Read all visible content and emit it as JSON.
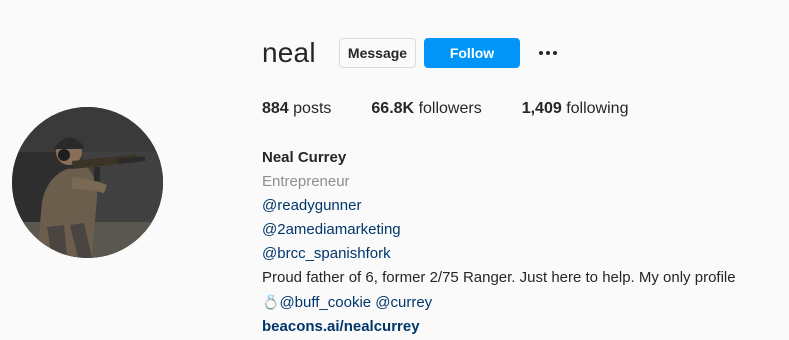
{
  "profile": {
    "username": "neal",
    "message_label": "Message",
    "follow_label": "Follow",
    "more_icon": "more-options-icon"
  },
  "stats": {
    "posts_count": "884",
    "posts_label": "posts",
    "followers_count": "66.8K",
    "followers_label": "followers",
    "following_count": "1,409",
    "following_label": "following"
  },
  "bio": {
    "full_name": "Neal Currey",
    "category": "Entrepreneur",
    "mentions": [
      "@readygunner",
      "@2amediamarketing",
      "@brcc_spanishfork"
    ],
    "description": "Proud father of 6, former 2/75 Ranger. Just here to help. My only profile",
    "ring_emoji": "💍",
    "tags_line": "@buff_cookie @currey",
    "link": "beacons.ai/nealcurrey"
  },
  "colors": {
    "background": "#fafafa",
    "follow_blue": "#0095f6",
    "link_blue": "#00376b",
    "muted_gray": "#8e8e8e",
    "text": "#262626"
  }
}
